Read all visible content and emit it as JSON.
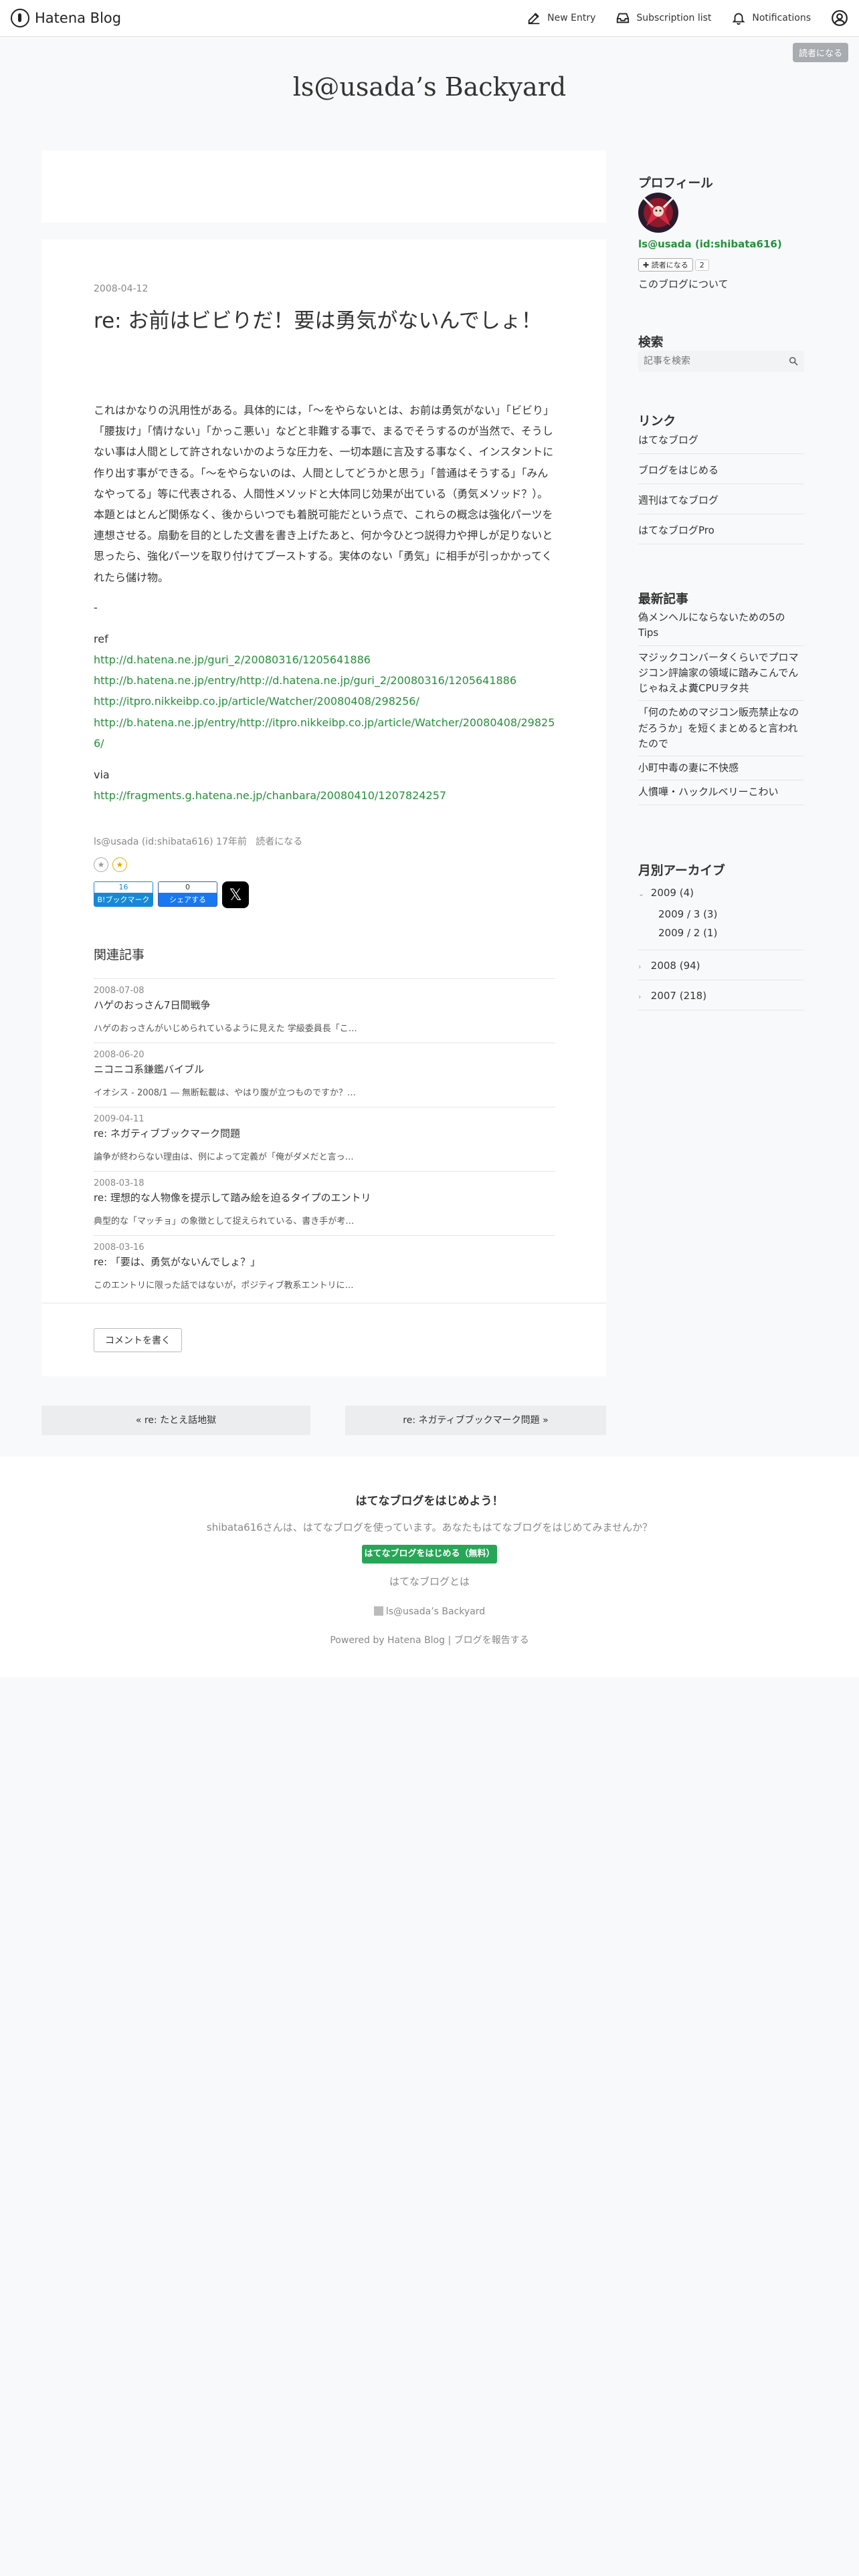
{
  "global_header": {
    "brand": "Hatena Blog",
    "nav": [
      {
        "label": "New Entry",
        "icon": "edit-icon"
      },
      {
        "label": "Subscription list",
        "icon": "inbox-icon"
      },
      {
        "label": "Notifications",
        "icon": "bell-icon"
      }
    ],
    "user_icon": "user-icon",
    "follow_tag": "読者になる"
  },
  "blog": {
    "title": "ls@usada’s Backyard"
  },
  "entry": {
    "date": "2008-04-12",
    "title": "re: お前はビビりだ！要は勇気がないんでしょ！",
    "paragraphs": [
      "これはかなりの汎用性がある。具体的には，「〜をやらないとは、お前は勇気がない」「ビビり」「腰抜け」「情けない」「かっこ悪い」などと非難する事で、まるでそうするのが当然で、そうしない事は人間として許されないかのような圧力を、一切本題に言及する事なく、インスタントに作り出す事ができる。「〜をやらないのは、人間としてどうかと思う」「普通はそうする」「みんなやってる」等に代表される、人間性メソッドと大体同じ効果が出ている（勇気メソッド？）。",
      "本題とはとんど関係なく、後からいつでも着脱可能だという点で、これらの概念は強化パーツを連想させる。扇動を目的とした文書を書き上げたあと、何か今ひとつ説得力や押しが足りないと思ったら、強化パーツを取り付けてブーストする。実体のない「勇気」に相手が引っかかってくれたら儲け物。"
    ],
    "dot": "-",
    "ref_label": "ref",
    "refs": [
      "http://d.hatena.ne.jp/guri_2/20080316/1205641886",
      "http://b.hatena.ne.jp/entry/http://d.hatena.ne.jp/guri_2/20080316/1205641886",
      "http://itpro.nikkeibp.co.jp/article/Watcher/20080408/298256/",
      "http://b.hatena.ne.jp/entry/http://itpro.nikkeibp.co.jp/article/Watcher/20080408/298256/"
    ],
    "via_label": "via",
    "via": "http://fragments.g.hatena.ne.jp/chanbara/20080410/1207824257",
    "meta": {
      "author": "ls@usada (id:shibata616)",
      "ago": "17年前",
      "follow": "読者になる"
    },
    "share": {
      "hatebu": {
        "count": "16",
        "label": "B!ブックマーク"
      },
      "facebook": {
        "count": "0",
        "label": "シェアする"
      },
      "x_label": "𝕏"
    }
  },
  "related": {
    "heading": "関連記事",
    "items": [
      {
        "date": "2008-07-08",
        "title": "ハゲのおっさん7日間戦争",
        "snippet": "ハゲのおっさんがいじめられているように見えた 学級委員長「こ…"
      },
      {
        "date": "2008-06-20",
        "title": "ニコニコ系鎌鑑バイブル",
        "snippet": "イオシス - 2008/1 ― 無断転載は、やはり腹が立つものですか？…"
      },
      {
        "date": "2009-04-11",
        "title": "re: ネガティブブックマーク問題",
        "snippet": "論争が終わらない理由は、例によって定義が「俺がダメだと言っ…"
      },
      {
        "date": "2008-03-18",
        "title": "re: 理想的な人物像を提示して踏み絵を迫るタイプのエントリ",
        "snippet": "典型的な「マッチョ」の象徴として捉えられている、書き手が考…"
      },
      {
        "date": "2008-03-16",
        "title": "re: 「要は、勇気がないんでしょ？」",
        "snippet": "このエントリに限った話ではないが，ポジティブ教系エントリに…"
      }
    ]
  },
  "comment_button": "コメントを書く",
  "pager": {
    "prev": "« re: たとえ話地獄",
    "next": "re: ネガティブブックマーク問題 »"
  },
  "sidebar": {
    "profile": {
      "heading": "プロフィール",
      "name": "ls@usada (id:shibata616)",
      "follow": "読者になる",
      "follower_count": "2",
      "about": "このブログについて"
    },
    "search": {
      "heading": "検索",
      "placeholder": "記事を検索"
    },
    "links": {
      "heading": "リンク",
      "items": [
        "はてなブログ",
        "ブログをはじめる",
        "週刊はてなブログ",
        "はてなブログPro"
      ]
    },
    "recent": {
      "heading": "最新記事",
      "items": [
        "偽メンヘルにならないための5のTips",
        "マジックコンバータくらいでプロマジコン評論家の領域に踏みこんでんじゃねえよ糞CPUヲタ共",
        "「何のためのマジコン販売禁止なのだろうか」を短くまとめると言われたので",
        "小町中毒の妻に不快感",
        "人慣嘩・ハックルベリーこわい"
      ]
    },
    "archive": {
      "heading": "月別アーカイブ",
      "years": [
        {
          "label": "2009 (4)",
          "expanded": true,
          "months": [
            "2009 / 3 (3)",
            "2009 / 2 (1)"
          ]
        },
        {
          "label": "2008 (94)",
          "expanded": false,
          "months": []
        },
        {
          "label": "2007 (218)",
          "expanded": false,
          "months": []
        }
      ]
    }
  },
  "footer": {
    "heading": "はてなブログをはじめよう！",
    "invite": "shibata616さんは、はてなブログを使っています。あなたもはてなブログをはじめてみませんか？",
    "start_button": "はてなブログをはじめる（無料）",
    "about": "はてなブログとは",
    "blog_name": "ls@usada’s Backyard",
    "powered": "Powered by Hatena Blog | ブログを報告する"
  },
  "colors": {
    "link": "#24903a",
    "hatebu": "#1689d6",
    "facebook": "#1877f2",
    "cta": "#27a657"
  }
}
